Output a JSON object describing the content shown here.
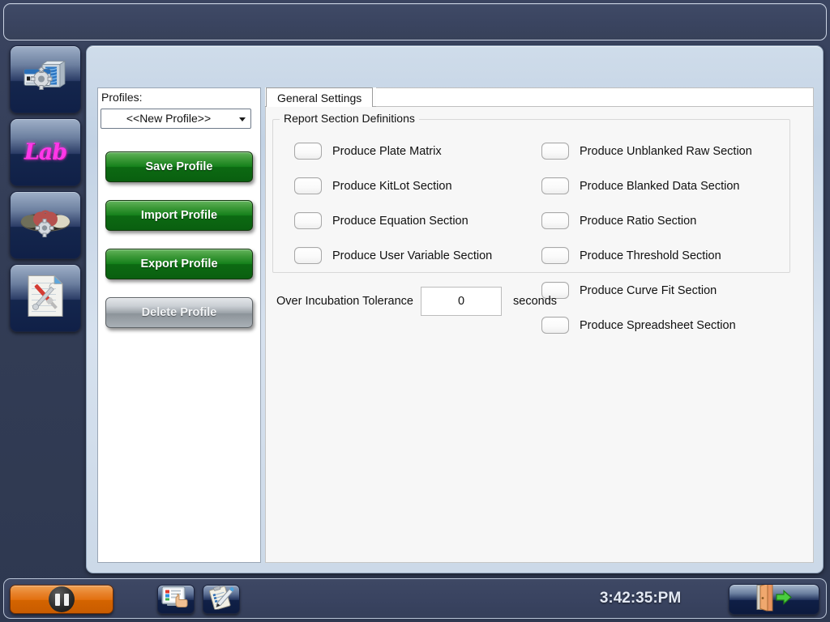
{
  "window": {
    "title": ""
  },
  "sidebar": {
    "items": [
      {
        "name": "instrument-settings",
        "icon": "instrument-gear-icon",
        "label": ""
      },
      {
        "name": "lab",
        "icon": "lab-logo-icon",
        "label": "Lab"
      },
      {
        "name": "assay-settings",
        "icon": "plate-gear-icon",
        "label": ""
      },
      {
        "name": "utilities",
        "icon": "document-tools-icon",
        "label": ""
      }
    ]
  },
  "profiles": {
    "label": "Profiles:",
    "selected": "<<New Profile>>",
    "caret_icon": "chevron-down-icon",
    "buttons": [
      {
        "label": "Save Profile",
        "state": "enabled"
      },
      {
        "label": "Import Profile",
        "state": "enabled"
      },
      {
        "label": "Export Profile",
        "state": "enabled"
      },
      {
        "label": "Delete Profile",
        "state": "disabled"
      }
    ]
  },
  "tabs": [
    {
      "label": "General Settings",
      "active": true
    }
  ],
  "general_settings": {
    "group_title": "Report Section Definitions",
    "left_column": [
      {
        "label": "Produce Plate Matrix",
        "checked": false
      },
      {
        "label": "Produce KitLot Section",
        "checked": false
      },
      {
        "label": "Produce Equation Section",
        "checked": false
      },
      {
        "label": "Produce User Variable Section",
        "checked": false
      }
    ],
    "right_column": [
      {
        "label": "Produce Unblanked Raw Section",
        "checked": false
      },
      {
        "label": "Produce Blanked Data Section",
        "checked": false
      },
      {
        "label": "Produce Ratio Section",
        "checked": false
      },
      {
        "label": "Produce Threshold Section",
        "checked": false
      },
      {
        "label": "Produce Curve Fit Section",
        "checked": false
      },
      {
        "label": "Produce Spreadsheet Section",
        "checked": false
      }
    ],
    "tolerance": {
      "label": "Over Incubation Tolerance",
      "value": "0",
      "unit": "seconds"
    }
  },
  "statusbar": {
    "pause_button": {
      "icon": "pause-icon",
      "label": ""
    },
    "icon_buttons": [
      {
        "icon": "touchscreen-icon",
        "label": ""
      },
      {
        "icon": "clipboard-checklist-icon",
        "label": ""
      }
    ],
    "clock": "3:42:35:PM",
    "exit_button": {
      "icon": "exit-door-icon",
      "label": ""
    }
  },
  "colors": {
    "frame": "#333d56",
    "panel": "#cfdcea",
    "button_green": "#14801a",
    "button_disabled": "#9aa1a7",
    "accent_orange": "#e2700f",
    "lab_magenta": "#ff37e8"
  }
}
